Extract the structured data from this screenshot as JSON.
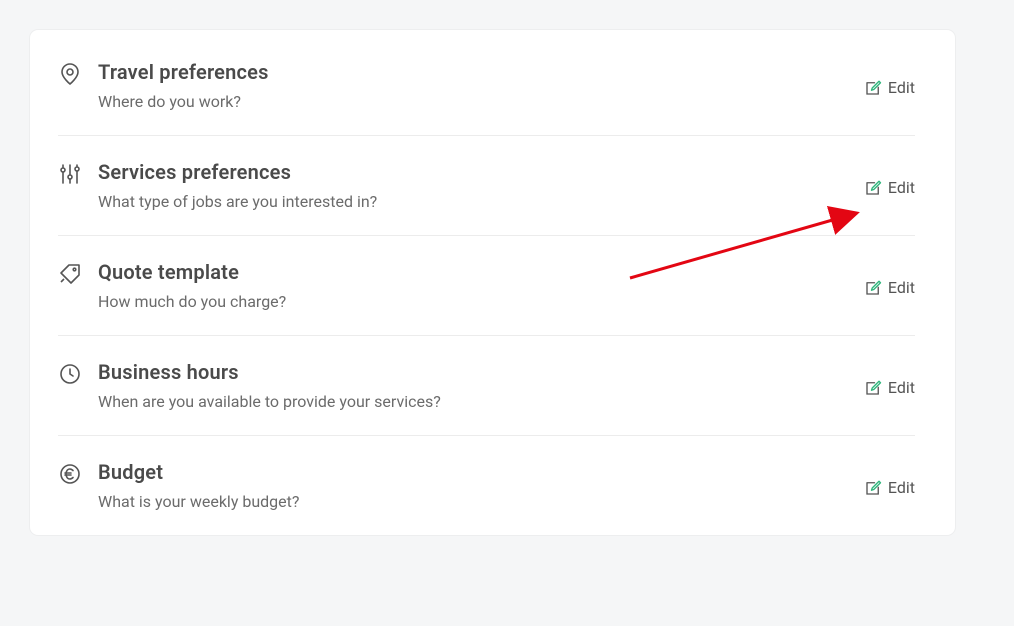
{
  "edit_label": "Edit",
  "sections": [
    {
      "key": "travel",
      "title": "Travel preferences",
      "subtitle": "Where do you work?"
    },
    {
      "key": "services",
      "title": "Services preferences",
      "subtitle": "What type of jobs are you interested in?"
    },
    {
      "key": "quote",
      "title": "Quote template",
      "subtitle": "How much do you charge?"
    },
    {
      "key": "hours",
      "title": "Business hours",
      "subtitle": "When are you available to provide your services?"
    },
    {
      "key": "budget",
      "title": "Budget",
      "subtitle": "What is your weekly budget?"
    }
  ]
}
